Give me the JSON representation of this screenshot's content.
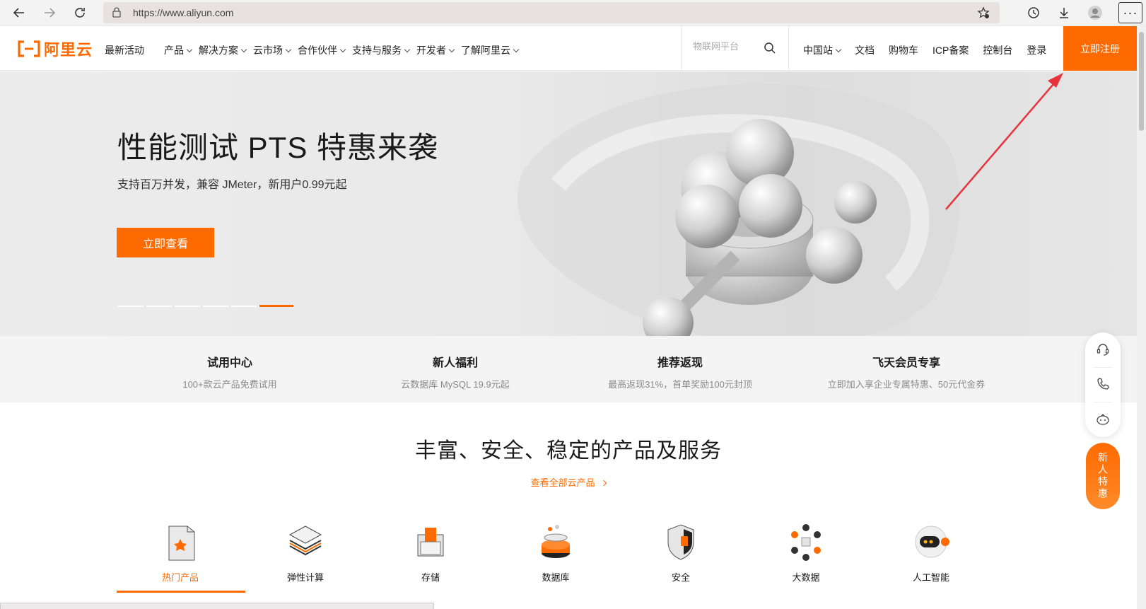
{
  "browser": {
    "url": "https://www.aliyun.com",
    "more_label": "···"
  },
  "header": {
    "logo_text": "阿里云",
    "nav": [
      "最新活动",
      "产品",
      "解决方案",
      "云市场",
      "合作伙伴",
      "支持与服务",
      "开发者",
      "了解阿里云"
    ],
    "search_placeholder": "物联网平台",
    "right_nav": [
      "中国站",
      "文档",
      "购物车",
      "ICP备案",
      "控制台",
      "登录"
    ],
    "register_label": "立即注册"
  },
  "hero": {
    "title": "性能测试 PTS 特惠来袭",
    "subtitle": "支持百万并发，兼容 JMeter，新用户0.99元起",
    "cta_label": "立即查看",
    "slide_count": 6,
    "active_slide": 6
  },
  "promo": [
    {
      "title": "试用中心",
      "desc": "100+款云产品免费试用"
    },
    {
      "title": "新人福利",
      "desc": "云数据库 MySQL 19.9元起"
    },
    {
      "title": "推荐返现",
      "desc": "最高返现31%，首单奖励100元封顶"
    },
    {
      "title": "飞天会员专享",
      "desc": "立即加入享企业专属特惠、50元代金券"
    }
  ],
  "float": {
    "newbie_label": "新人特惠",
    "tools": [
      "headset-icon",
      "phone-icon",
      "chat-bot-icon"
    ]
  },
  "section": {
    "title": "丰富、安全、稳定的产品及服务",
    "link": "查看全部云产品",
    "categories": [
      "热门产品",
      "弹性计算",
      "存储",
      "数据库",
      "安全",
      "大数据",
      "人工智能"
    ],
    "active_category": "热门产品"
  },
  "colors": {
    "accent": "#ff6a00",
    "annotation_arrow": "#e8333a"
  }
}
